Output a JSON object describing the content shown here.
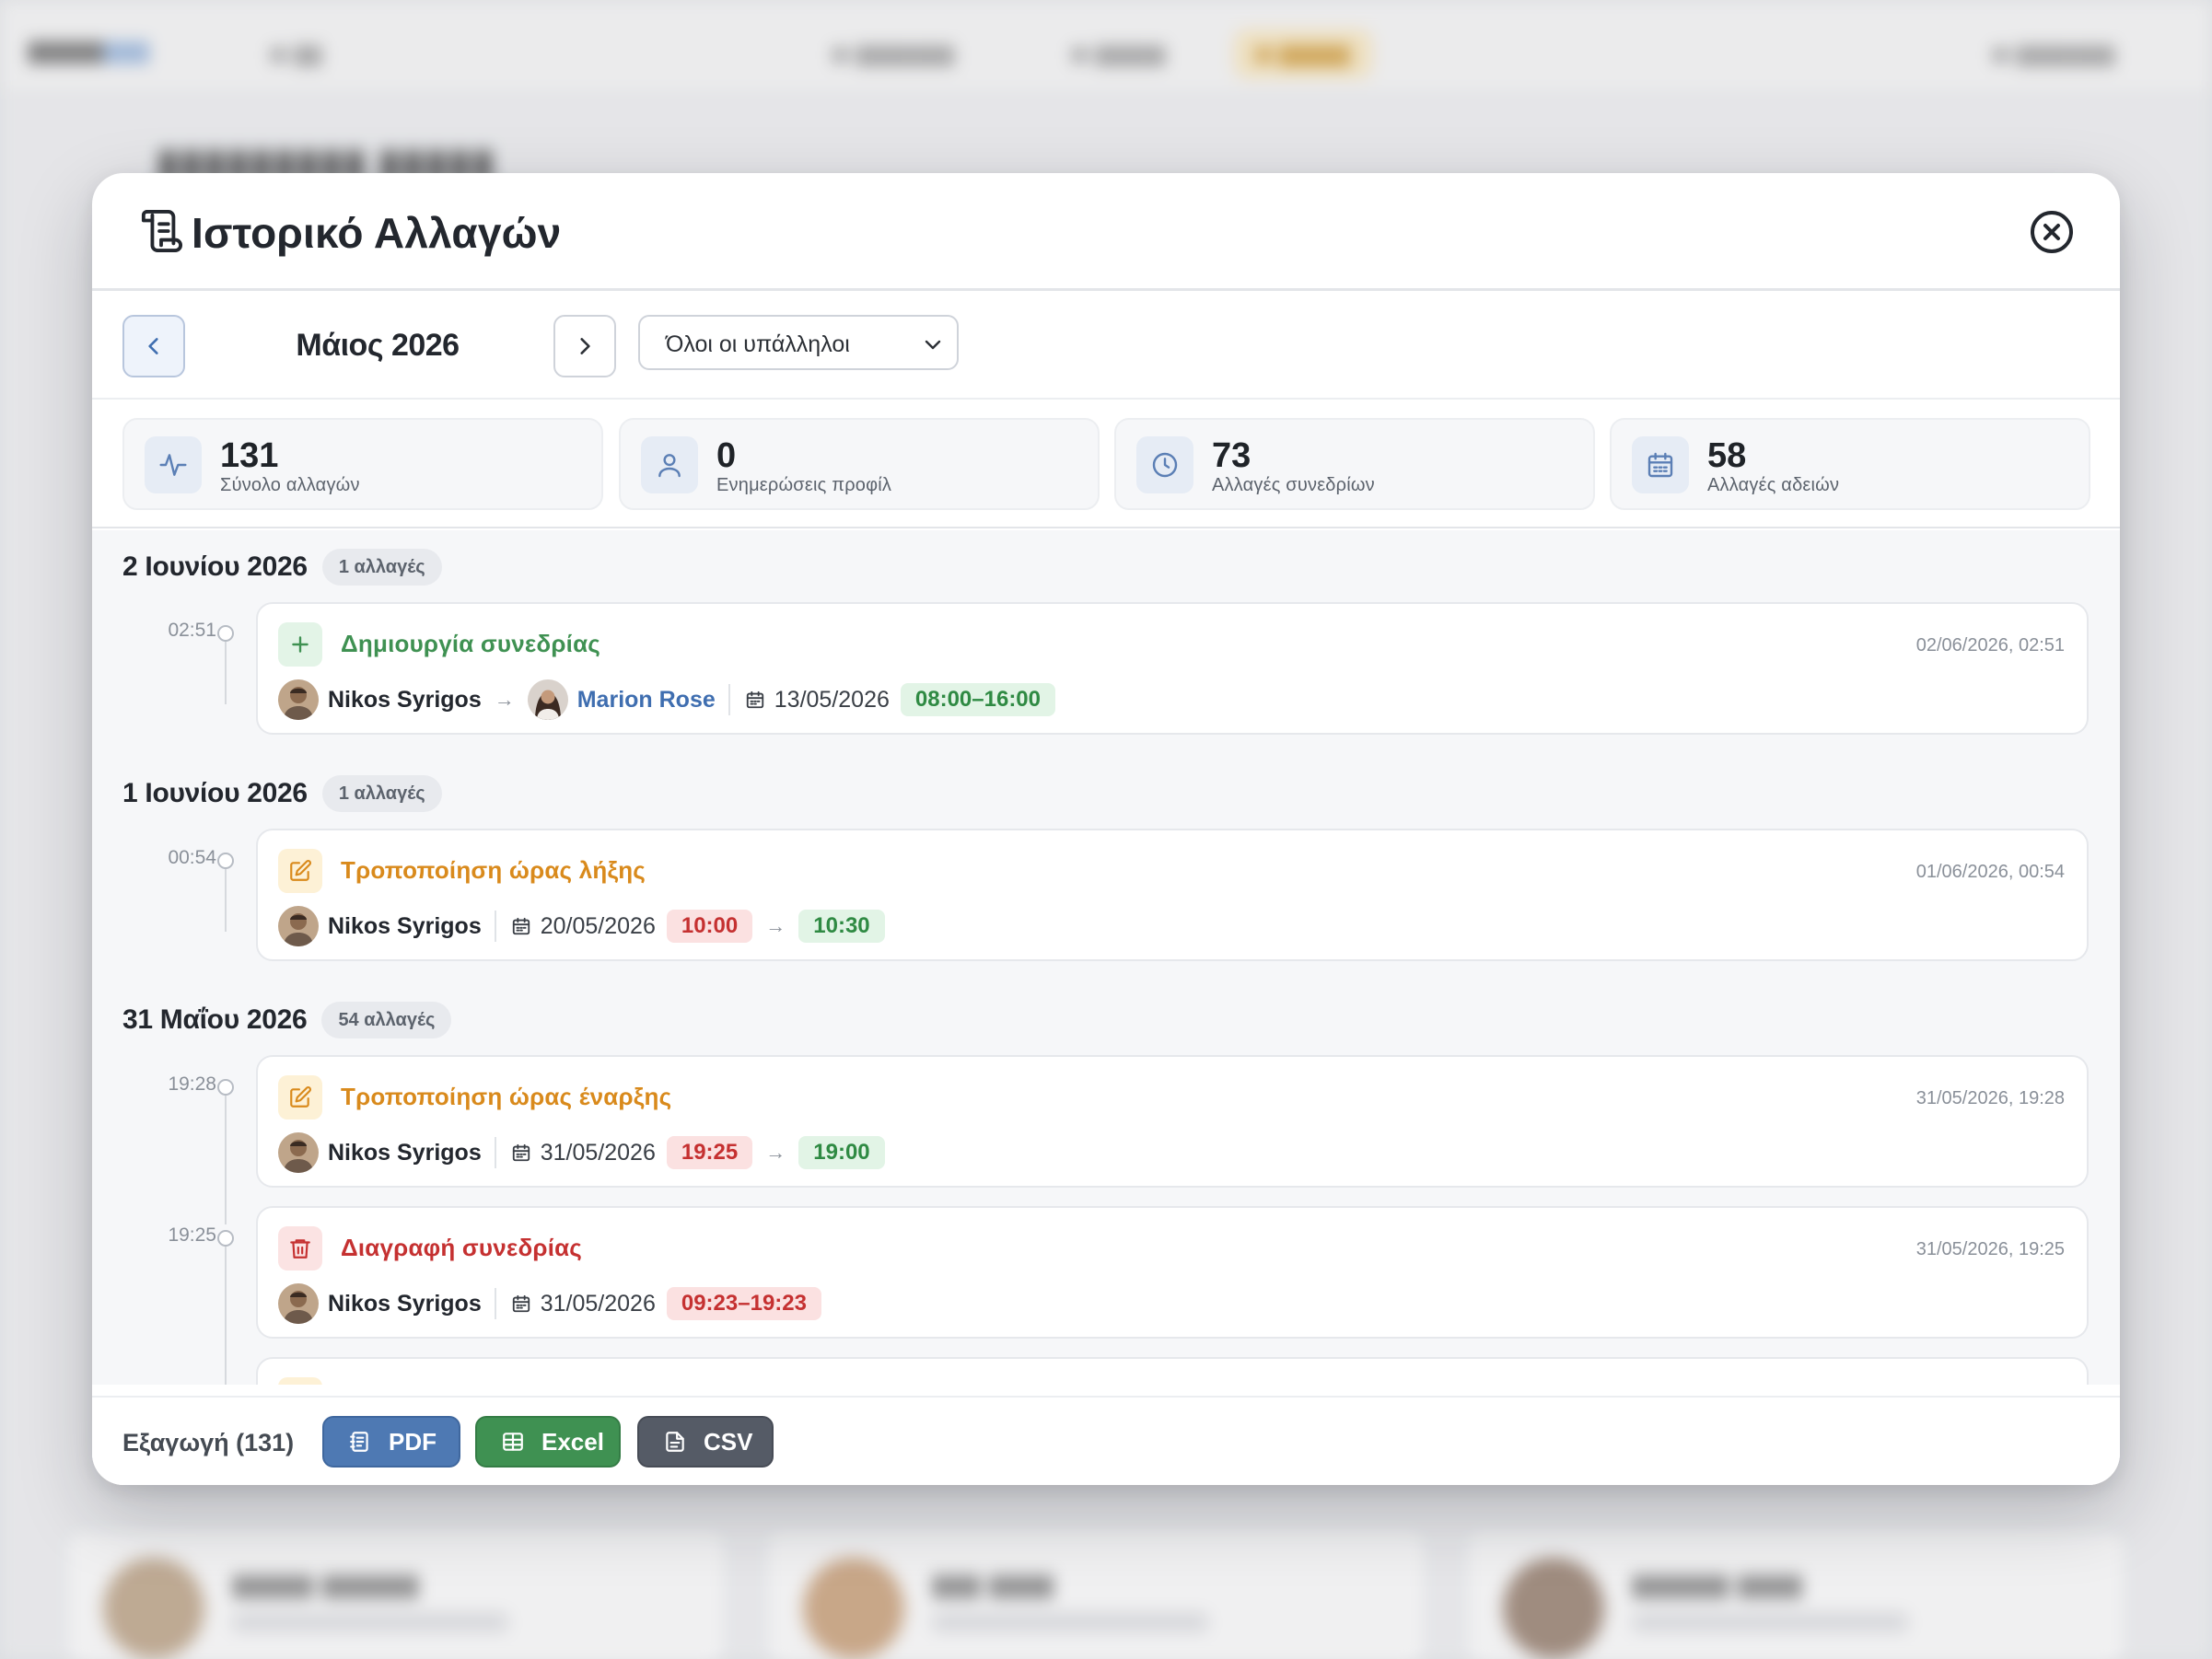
{
  "modal": {
    "title": "Ιστορικό Αλλαγών",
    "month": "Μάιος 2026",
    "employee_filter": "Όλοι οι υπάλληλοι"
  },
  "stats": [
    {
      "value": "131",
      "label": "Σύνολο αλλαγών",
      "icon": "activity-icon"
    },
    {
      "value": "0",
      "label": "Ενημερώσεις προφίλ",
      "icon": "user-icon"
    },
    {
      "value": "73",
      "label": "Αλλαγές συνεδρίων",
      "icon": "clock-icon"
    },
    {
      "value": "58",
      "label": "Αλλαγές αδειών",
      "icon": "calendar-icon"
    }
  ],
  "days": [
    {
      "title": "2 Ιουνίου 2026",
      "badge": "1 αλλαγές",
      "entries": [
        {
          "time": "02:51",
          "type": "create",
          "title": "Δημιουργία συνεδρίας",
          "stamp": "02/06/2026, 02:51",
          "actor": "Nikos Syrigos",
          "target": "Marion Rose",
          "date": "13/05/2026",
          "range": "08:00–16:00"
        }
      ]
    },
    {
      "title": "1 Ιουνίου 2026",
      "badge": "1 αλλαγές",
      "entries": [
        {
          "time": "00:54",
          "type": "edit",
          "title": "Τροποποίηση ώρας λήξης",
          "stamp": "01/06/2026, 00:54",
          "actor": "Nikos Syrigos",
          "date": "20/05/2026",
          "old": "10:00",
          "new": "10:30"
        }
      ]
    },
    {
      "title": "31 Μαΐου 2026",
      "badge": "54 αλλαγές",
      "entries": [
        {
          "time": "19:28",
          "type": "edit",
          "title": "Τροποποίηση ώρας έναρξης",
          "stamp": "31/05/2026, 19:28",
          "actor": "Nikos Syrigos",
          "date": "31/05/2026",
          "old": "19:25",
          "new": "19:00"
        },
        {
          "time": "19:25",
          "type": "delete",
          "title": "Διαγραφή συνεδρίας",
          "stamp": "31/05/2026, 19:25",
          "actor": "Nikos Syrigos",
          "date": "31/05/2026",
          "range": "09:23–19:23"
        }
      ]
    }
  ],
  "footer": {
    "export_label": "Εξαγωγή (131)",
    "pdf": "PDF",
    "excel": "Excel",
    "csv": "CSV"
  },
  "colors": {
    "create": "#3f9152",
    "edit": "#d98a1c",
    "delete": "#c53131",
    "accent": "#4e79b3"
  }
}
